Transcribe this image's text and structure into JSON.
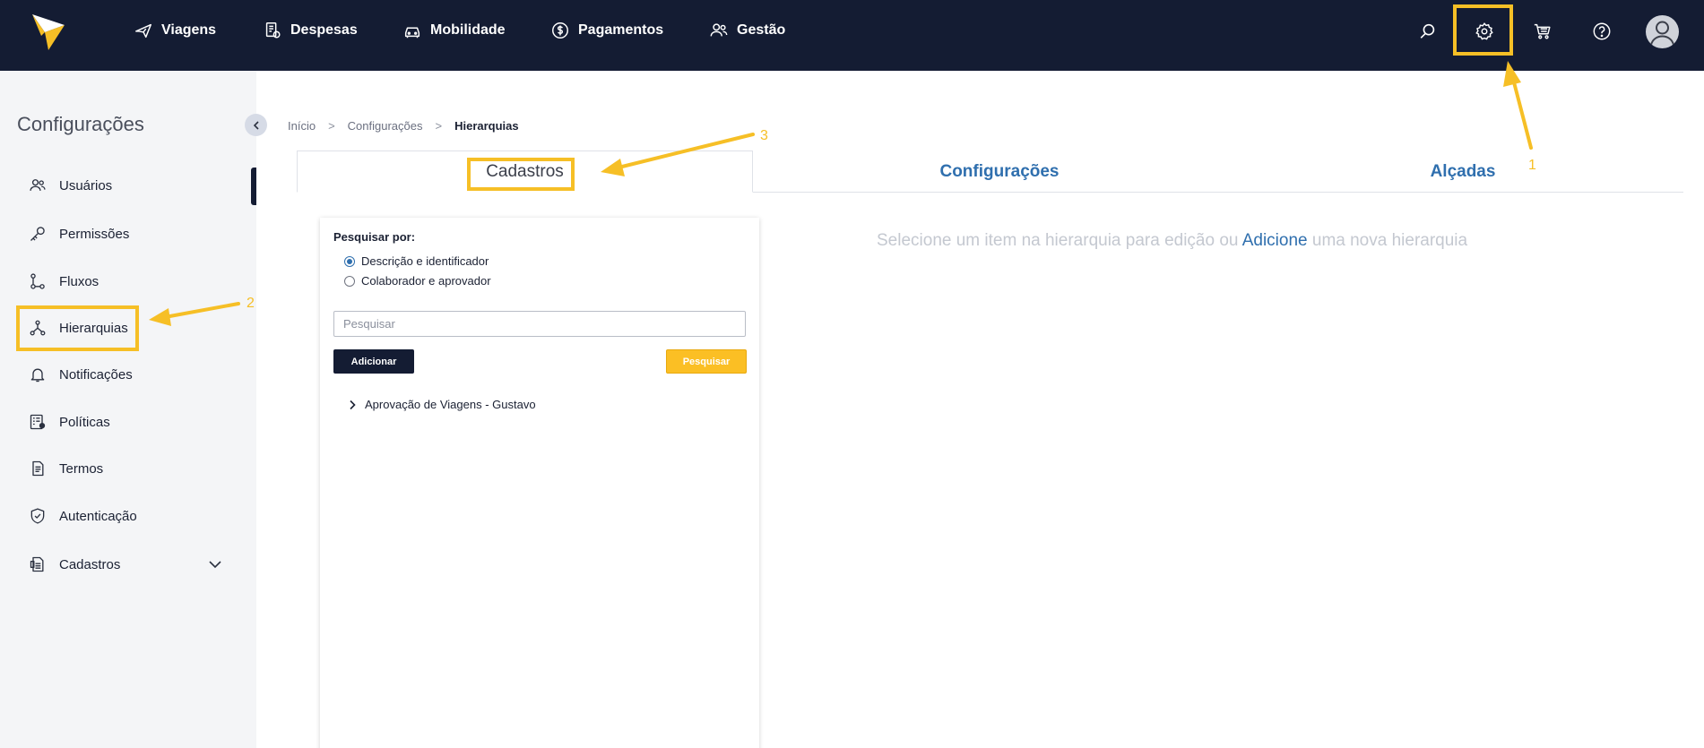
{
  "topbar": {
    "nav": [
      {
        "label": "Viagens",
        "icon": "airplane-icon"
      },
      {
        "label": "Despesas",
        "icon": "receipt-icon"
      },
      {
        "label": "Mobilidade",
        "icon": "car-icon"
      },
      {
        "label": "Pagamentos",
        "icon": "dollar-coin-icon"
      },
      {
        "label": "Gestão",
        "icon": "users-icon"
      }
    ]
  },
  "sidebar": {
    "title": "Configurações",
    "items": [
      {
        "label": "Usuários",
        "icon": "users-icon"
      },
      {
        "label": "Permissões",
        "icon": "key-icon"
      },
      {
        "label": "Fluxos",
        "icon": "flow-icon"
      },
      {
        "label": "Hierarquias",
        "icon": "hierarchy-icon"
      },
      {
        "label": "Notificações",
        "icon": "bell-icon"
      },
      {
        "label": "Políticas",
        "icon": "policy-icon"
      },
      {
        "label": "Termos",
        "icon": "document-icon"
      },
      {
        "label": "Autenticação",
        "icon": "shield-icon"
      },
      {
        "label": "Cadastros",
        "icon": "file-list-icon"
      }
    ]
  },
  "breadcrumb": {
    "items": [
      "Início",
      "Configurações",
      "Hierarquias"
    ],
    "separator": ">"
  },
  "tabs": [
    {
      "label": "Cadastros",
      "active": true
    },
    {
      "label": "Configurações",
      "active": false
    },
    {
      "label": "Alçadas",
      "active": false
    }
  ],
  "panel": {
    "search_by_label": "Pesquisar por:",
    "options": [
      {
        "label": "Descrição e identificador",
        "checked": true
      },
      {
        "label": "Colaborador e aprovador",
        "checked": false
      }
    ],
    "search_placeholder": "Pesquisar",
    "add_label": "Adicionar",
    "search_label": "Pesquisar",
    "tree": [
      {
        "label": "Aprovação de Viagens - Gustavo"
      }
    ]
  },
  "empty_state": {
    "before": "Selecione um item na hierarquia para edição ou ",
    "link": "Adicione",
    "after": " uma nova hierarquia"
  },
  "annotations": [
    "1",
    "2",
    "3"
  ],
  "colors": {
    "navbar": "#141c33",
    "accent": "#f6bf26",
    "link": "#2f6fae",
    "search_button": "#fbbf24"
  }
}
